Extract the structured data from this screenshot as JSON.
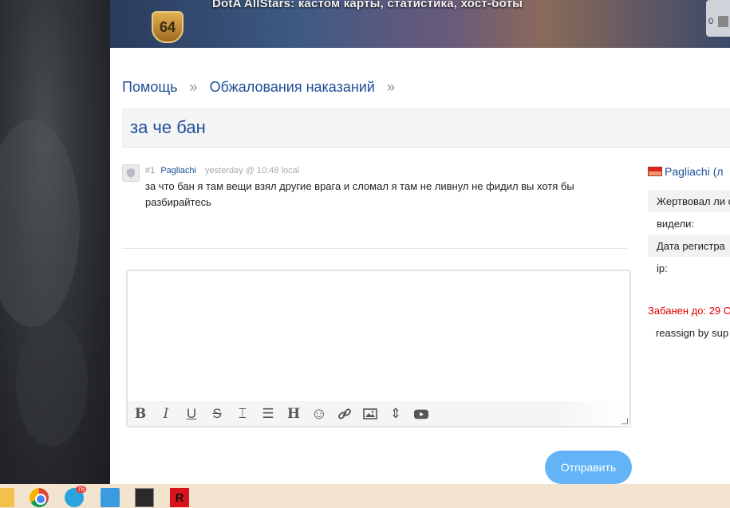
{
  "banner": {
    "title": "DotA AllStars: кастом карты, статистика, хост-боты",
    "level": "64",
    "widget_count": "0"
  },
  "breadcrumb": {
    "items": [
      "Помощь",
      "Обжалования наказаний"
    ],
    "separator": "»"
  },
  "thread": {
    "title": "за че бан"
  },
  "post": {
    "number": "#1",
    "author": "Pagliachi",
    "time": "yesterday @ 10:48 local",
    "body": "за что бан я там вещи взял другие врага и сломал я там не ливнул не фидил вы хотя бы разбирайтесь"
  },
  "editor": {
    "value": "",
    "toolbar": [
      {
        "name": "bold-icon",
        "glyph": "B"
      },
      {
        "name": "italic-icon",
        "glyph": "I"
      },
      {
        "name": "underline-icon",
        "glyph": "U"
      },
      {
        "name": "strikethrough-icon",
        "glyph": "S"
      },
      {
        "name": "text-height-icon",
        "glyph": "⌶"
      },
      {
        "name": "list-icon",
        "glyph": "☰"
      },
      {
        "name": "heading-icon",
        "glyph": "H"
      },
      {
        "name": "emoji-icon",
        "glyph": "☺"
      },
      {
        "name": "link-icon",
        "glyph": "🔗"
      },
      {
        "name": "image-icon",
        "glyph": "▣"
      },
      {
        "name": "collapse-icon",
        "glyph": "⇕"
      },
      {
        "name": "youtube-icon",
        "glyph": "▶"
      }
    ]
  },
  "send_button": "Отправить",
  "user_panel": {
    "name": "Pagliachi (л",
    "rows": [
      "Жертвовал ли с",
      "видели:",
      "Дата регистра",
      "ip:"
    ],
    "banned": "Забанен до: 29 О",
    "reassign": "reassign by sup"
  },
  "colors": {
    "link": "#1f4e96",
    "send_button": "#63b3f7",
    "banned": "#e00000"
  },
  "taskbar": {
    "telegram_badge": "76",
    "red_app_letter": "R"
  }
}
